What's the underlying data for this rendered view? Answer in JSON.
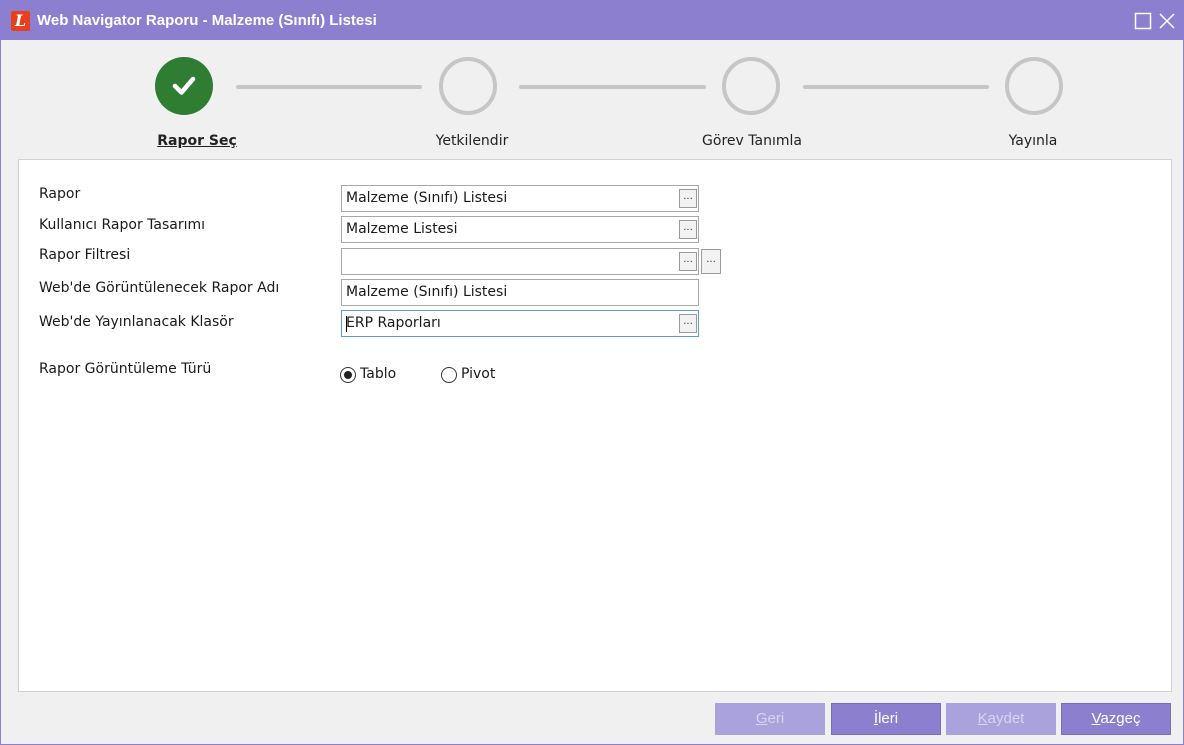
{
  "window": {
    "title": "Web Navigator Raporu - Malzeme (Sınıfı) Listesi",
    "logo_letter": "L",
    "title_color": "#8c7fd0"
  },
  "steps": [
    {
      "label": "Rapor Seç",
      "state": "done",
      "icon": "check-icon"
    },
    {
      "label": "Yetkilendir",
      "state": "pending"
    },
    {
      "label": "Görev Tanımla",
      "state": "pending"
    },
    {
      "label": "Yayınla",
      "state": "pending"
    }
  ],
  "form": {
    "rapor": {
      "label": "Rapor",
      "value": "Malzeme (Sınıfı) Listesi",
      "button": "..."
    },
    "tasarim": {
      "label": "Kullanıcı Rapor Tasarımı",
      "value": "Malzeme Listesi",
      "button": "..."
    },
    "filtre": {
      "label": "Rapor Filtresi",
      "value": "",
      "button": "...",
      "button2": "..."
    },
    "rapor_adi": {
      "label": "Web'de Görüntülenecek Rapor Adı",
      "value": "Malzeme (Sınıfı) Listesi"
    },
    "klasor": {
      "label": "Web'de Yayınlanacak Klasör",
      "value": "ERP Raporları",
      "button": "..."
    },
    "goruntuleme": {
      "label": "Rapor Görüntüleme Türü",
      "options": [
        "Tablo",
        "Pivot"
      ],
      "selected": "Tablo"
    }
  },
  "footer": {
    "geri_first": "G",
    "geri_rest": "eri",
    "geri_disabled": true,
    "ileri_first": "İ",
    "ileri_rest": "leri",
    "kaydet_first": "K",
    "kaydet_rest": "aydet",
    "kaydet_disabled": true,
    "vazgec_first": "V",
    "vazgec_rest": "azgeç"
  },
  "colors": {
    "accent": "#8c7fd0",
    "done_step": "#2e7d32"
  }
}
